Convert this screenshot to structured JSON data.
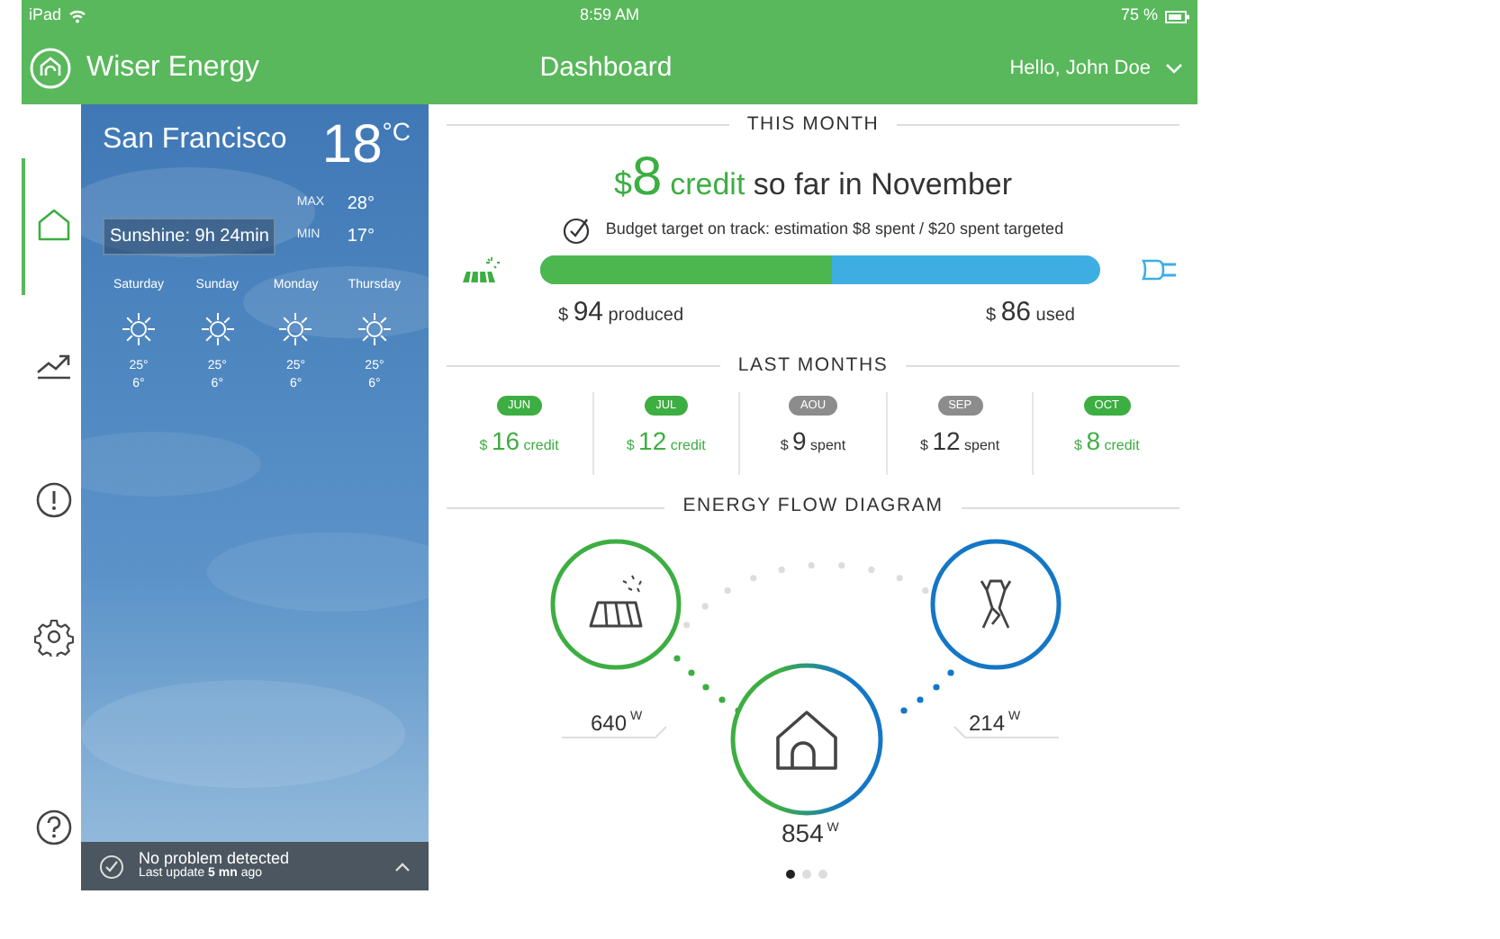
{
  "status_bar": {
    "device": "iPad",
    "time": "8:59 AM",
    "battery": "75 %"
  },
  "header": {
    "app_name": "Wiser Energy",
    "title": "Dashboard",
    "user": "Hello, John Doe"
  },
  "nav": [
    {
      "kind": "home",
      "selected": true
    },
    {
      "kind": "chart",
      "selected": false
    },
    {
      "kind": "alert",
      "selected": false
    },
    {
      "kind": "settings",
      "selected": false
    },
    {
      "kind": "help",
      "selected": false
    }
  ],
  "weather": {
    "city": "San Francisco",
    "temperature": "18",
    "unit": "°C",
    "max_label": "MAX",
    "max": "28°",
    "min_label": "MIN",
    "min": "17°",
    "sunshine": "Sunshine: 9h 24min",
    "forecast": [
      {
        "day": "Saturday",
        "high": "25°",
        "low": "6°"
      },
      {
        "day": "Sunday",
        "high": "25°",
        "low": "6°"
      },
      {
        "day": "Monday",
        "high": "25°",
        "low": "6°"
      },
      {
        "day": "Thursday",
        "high": "25°",
        "low": "6°"
      }
    ],
    "status": {
      "message": "No problem detected",
      "update": "Last update **5 mn** ago"
    }
  },
  "this_month": {
    "heading": "THIS MONTH",
    "currency": "$",
    "amount": "8",
    "amount_label": "credit",
    "rest": "so far in November",
    "budget": "Budget target on track: estimation $8 spent / $20 spent targeted",
    "level": 0.52,
    "produced": {
      "currency": "$",
      "amount": "94",
      "label": "produced"
    },
    "used": {
      "currency": "$",
      "amount": "86",
      "label": "used"
    }
  },
  "last_months": {
    "heading": "LAST MONTHS",
    "months": [
      {
        "month": "JUN",
        "currency": "$",
        "amount": "16",
        "label": "credit",
        "kind": "credit"
      },
      {
        "month": "JUL",
        "currency": "$",
        "amount": "12",
        "label": "credit",
        "kind": "credit"
      },
      {
        "month": "AOU",
        "currency": "$",
        "amount": "9",
        "label": "spent",
        "kind": "spent"
      },
      {
        "month": "SEP",
        "currency": "$",
        "amount": "12",
        "label": "spent",
        "kind": "spent"
      },
      {
        "month": "OCT",
        "currency": "$",
        "amount": "8",
        "label": "credit",
        "kind": "credit"
      }
    ]
  },
  "energy_flow": {
    "heading": "ENERGY FLOW DIAGRAM",
    "solar": {
      "value": "640",
      "unit": "W"
    },
    "grid": {
      "value": "214",
      "unit": "W"
    },
    "home": {
      "value": "854",
      "unit": "W"
    },
    "pages": [
      {
        "selected": true
      },
      {
        "selected": false
      },
      {
        "selected": false
      }
    ]
  }
}
